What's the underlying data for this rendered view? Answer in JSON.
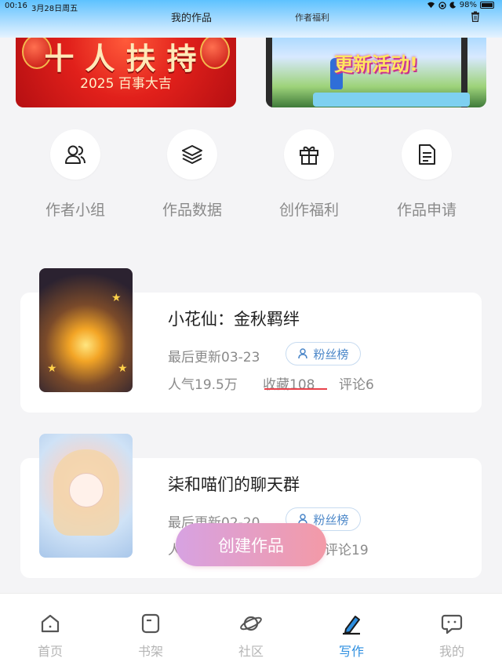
{
  "status": {
    "time": "00:16",
    "date": "3月28日周五",
    "battery": "98%"
  },
  "header": {
    "tabs": [
      {
        "label": "我的作品",
        "active": true
      },
      {
        "label": "作者福利",
        "active": false
      }
    ],
    "trash_icon": "trash-icon"
  },
  "banners": [
    {
      "headline": "十人扶持",
      "subtitle": "2025 百事大吉"
    },
    {
      "headline": "更新活动!"
    }
  ],
  "actions": [
    {
      "label": "作者小组",
      "icon": "users-icon"
    },
    {
      "label": "作品数据",
      "icon": "layers-icon"
    },
    {
      "label": "创作福利",
      "icon": "gift-icon"
    },
    {
      "label": "作品申请",
      "icon": "document-icon"
    }
  ],
  "works": [
    {
      "title": "小花仙：金秋羁绊",
      "updated": "最后更新03-23",
      "fans_button": "粉丝榜",
      "popularity": "人气19.5万",
      "favorites": "收藏108",
      "comments": "评论6"
    },
    {
      "title": "柒和喵们的聊天群",
      "updated": "最后更新02-20",
      "fans_button": "粉丝榜",
      "popularity": "人",
      "comments": "评论19"
    }
  ],
  "create_button": "创建作品",
  "bottom_nav": [
    {
      "label": "首页",
      "icon": "home-icon",
      "active": false
    },
    {
      "label": "书架",
      "icon": "bookshelf-icon",
      "active": false
    },
    {
      "label": "社区",
      "icon": "planet-icon",
      "active": false
    },
    {
      "label": "写作",
      "icon": "pen-icon",
      "active": true
    },
    {
      "label": "我的",
      "icon": "chat-bubble-icon",
      "active": false
    }
  ],
  "colors": {
    "accent": "#2e8fe0",
    "favorites_underline": "#e8424a",
    "create_gradient_start": "#d7a2e2",
    "create_gradient_end": "#f39aa7"
  }
}
